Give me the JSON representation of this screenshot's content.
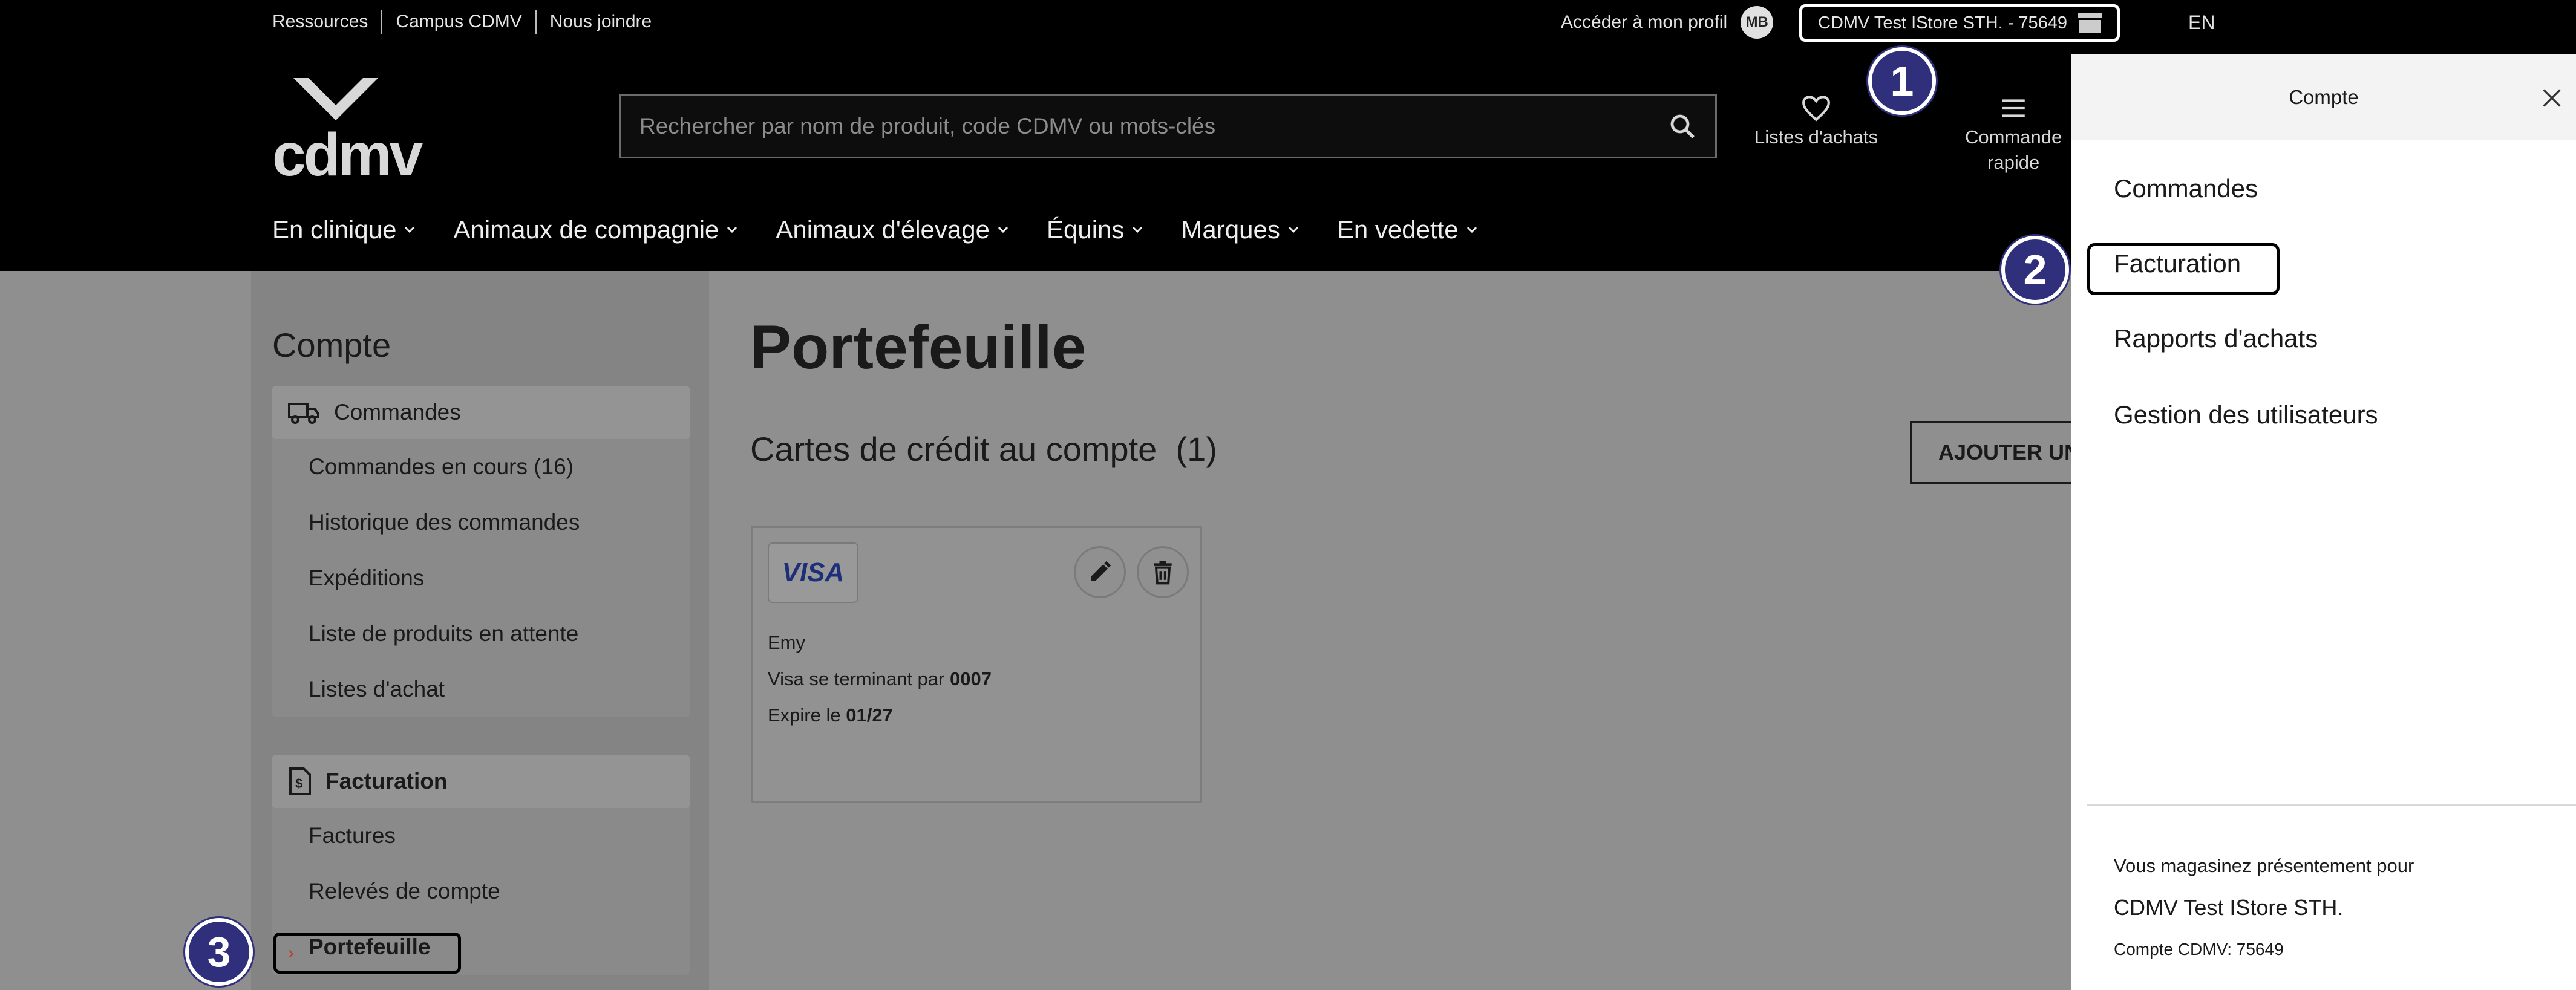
{
  "header": {
    "util_links": [
      "Ressources",
      "Campus CDMV",
      "Nous joindre"
    ],
    "profile_label": "Accéder à mon profil",
    "avatar_initials": "MB",
    "store_label": "CDMV Test IStore STH. - 75649",
    "language": "EN",
    "logo_text": "cdmv",
    "search_placeholder": "Rechercher par nom de produit, code CDMV ou mots-clés",
    "wishlist_label": "Listes d'achats",
    "quick_order_line1": "Commande",
    "quick_order_line2": "rapide",
    "nav": [
      "En clinique",
      "Animaux de compagnie",
      "Animaux d'élevage",
      "Équins",
      "Marques",
      "En vedette"
    ]
  },
  "sidebar": {
    "title": "Compte",
    "orders_heading": "Commandes",
    "orders_items": [
      "Commandes en cours (16)",
      "Historique des commandes",
      "Expéditions",
      "Liste de produits en attente",
      "Listes d'achat"
    ],
    "billing_heading": "Facturation",
    "billing_items": [
      "Factures",
      "Relevés de compte",
      "Portefeuille"
    ]
  },
  "main": {
    "page_title": "Portefeuille",
    "section_title": "Cartes de crédit au compte",
    "card_count": "(1)",
    "add_button": "AJOUTER UNE CARTE",
    "card": {
      "brand": "VISA",
      "holder": "Emy",
      "ending_prefix": "Visa se terminant par ",
      "ending_digits": "0007",
      "expiry_prefix": "Expire le ",
      "expiry_value": "01/27"
    }
  },
  "panel": {
    "title": "Compte",
    "items": [
      "Commandes",
      "Facturation",
      "Rapports d'achats",
      "Gestion des utilisateurs"
    ],
    "shopping_for_label": "Vous magasinez présentement pour",
    "store_name": "CDMV Test IStore STH.",
    "account_label": "Compte CDMV: 75649"
  },
  "badges": [
    "1",
    "2",
    "3"
  ],
  "colors": {
    "header_bg": "#000000",
    "badge_bg": "#2f2f7c",
    "overlay_gray": "#8f8f8f",
    "visa_blue": "#1e2f7a"
  }
}
